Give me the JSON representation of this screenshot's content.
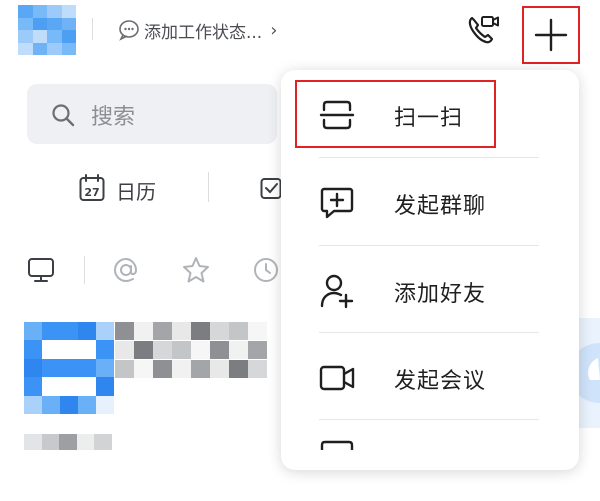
{
  "header": {
    "status_text": "添加工作状态...",
    "status_chevron": "›",
    "icons": {
      "call": "video-call-icon",
      "plus": "plus-icon",
      "status": "chat-bubble-icon"
    }
  },
  "search": {
    "placeholder": "搜索"
  },
  "toolbar": {
    "calendar_label": "日历",
    "calendar_day": "27"
  },
  "quick_filters": [
    "monitor-icon",
    "at-icon",
    "star-icon",
    "clock-icon"
  ],
  "menu": {
    "items": [
      {
        "label": "扫一扫",
        "icon": "scan-icon"
      },
      {
        "label": "发起群聊",
        "icon": "group-chat-icon"
      },
      {
        "label": "添加好友",
        "icon": "add-friend-icon"
      },
      {
        "label": "发起会议",
        "icon": "video-meeting-icon"
      }
    ]
  },
  "colors": {
    "highlight": "#e02222",
    "avatar_blue": "#3b93f5",
    "search_bg": "#eef0f3"
  }
}
